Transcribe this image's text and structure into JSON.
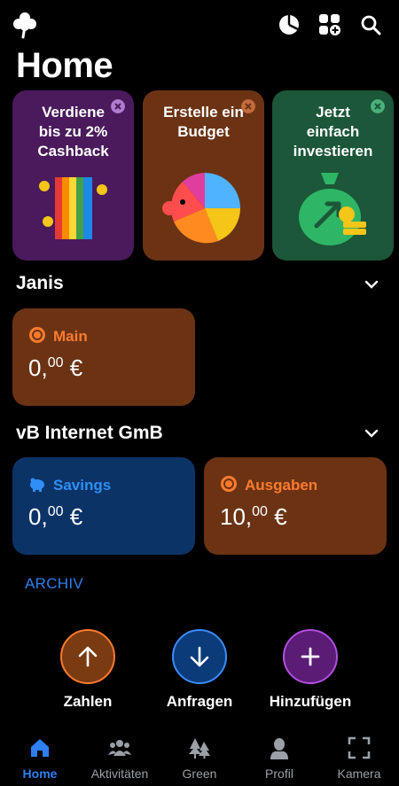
{
  "page": {
    "title": "Home"
  },
  "header": {
    "icons": [
      "clover-logo-icon",
      "pie-chart-icon",
      "add-widget-icon",
      "search-icon"
    ]
  },
  "promos": [
    {
      "text": "Verdiene\nbis zu 2%\nCashback",
      "bg": "#4a1a5c",
      "close_color": "#b07cd0",
      "art": "bunq-cards-with-coins"
    },
    {
      "text": "Erstelle ein\nBudget",
      "bg": "#6b3314",
      "close_color": "#c26b3c",
      "art": "colorful-piggy-bank"
    },
    {
      "text": "Jetzt\neinfach\ninvestieren",
      "bg": "#1b5738",
      "close_color": "#4bb07a",
      "art": "money-bag-with-coins"
    }
  ],
  "sections": [
    {
      "title": "Janis",
      "accounts": [
        {
          "name": "Main",
          "amount_main": "0,",
          "amount_cents": "00",
          "currency": "€",
          "bg": "#6b3314",
          "accent": "#ff7a2e",
          "icon": "coin-icon"
        }
      ]
    },
    {
      "title": "vB Internet GmB",
      "accounts": [
        {
          "name": "Savings",
          "amount_main": "0,",
          "amount_cents": "00",
          "currency": "€",
          "bg": "#0c3366",
          "accent": "#2f8ff7",
          "icon": "piggy-bank-icon"
        },
        {
          "name": "Ausgaben",
          "amount_main": "10,",
          "amount_cents": "00",
          "currency": "€",
          "bg": "#6b3314",
          "accent": "#ff7a2e",
          "icon": "coin-icon"
        }
      ]
    }
  ],
  "archive_label": "ARCHIV",
  "actions": [
    {
      "label": "Zahlen",
      "icon": "arrow-up-icon",
      "bg": "#7a3a12",
      "ring": "#ff7a2e"
    },
    {
      "label": "Anfragen",
      "icon": "arrow-down-icon",
      "bg": "#0c3b7a",
      "ring": "#3a8cff"
    },
    {
      "label": "Hinzufügen",
      "icon": "plus-icon",
      "bg": "#5a1c75",
      "ring": "#b14fe0"
    }
  ],
  "nav": [
    {
      "label": "Home",
      "icon": "home-icon",
      "active": true
    },
    {
      "label": "Aktivitäten",
      "icon": "people-icon",
      "active": false
    },
    {
      "label": "Green",
      "icon": "trees-icon",
      "active": false
    },
    {
      "label": "Profil",
      "icon": "profile-icon",
      "active": false
    },
    {
      "label": "Kamera",
      "icon": "camera-scan-icon",
      "active": false
    }
  ],
  "colors": {
    "accent_blue": "#2f7ff0",
    "background": "#000000"
  }
}
